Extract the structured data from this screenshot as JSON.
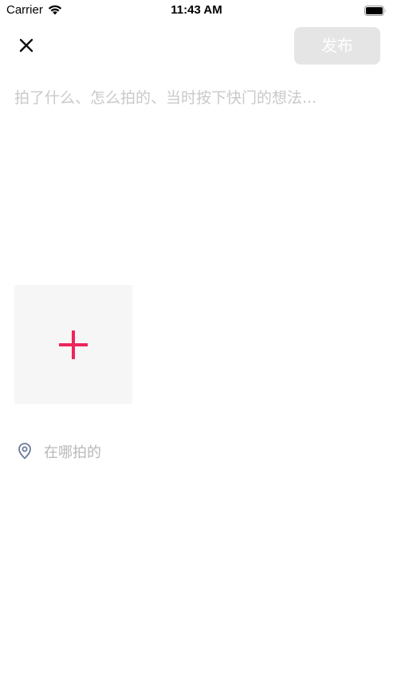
{
  "status_bar": {
    "carrier": "Carrier",
    "time": "11:43 AM",
    "icons": [
      "wifi-icon",
      "battery-icon"
    ]
  },
  "nav": {
    "close_icon": "close-icon",
    "publish_label": "发布",
    "publish_enabled": false,
    "publish_bg_color": "#e5e5e5"
  },
  "composer": {
    "caption_placeholder": "拍了什么、怎么拍的、当时按下快门的想法...",
    "caption_value": ""
  },
  "media": {
    "add_icon": "plus-icon",
    "add_icon_color": "#f0245c",
    "tile_bg_color": "#f6f6f6"
  },
  "location": {
    "icon": "location-pin-icon",
    "placeholder": "在哪拍的",
    "icon_color": "#6b7a99"
  }
}
